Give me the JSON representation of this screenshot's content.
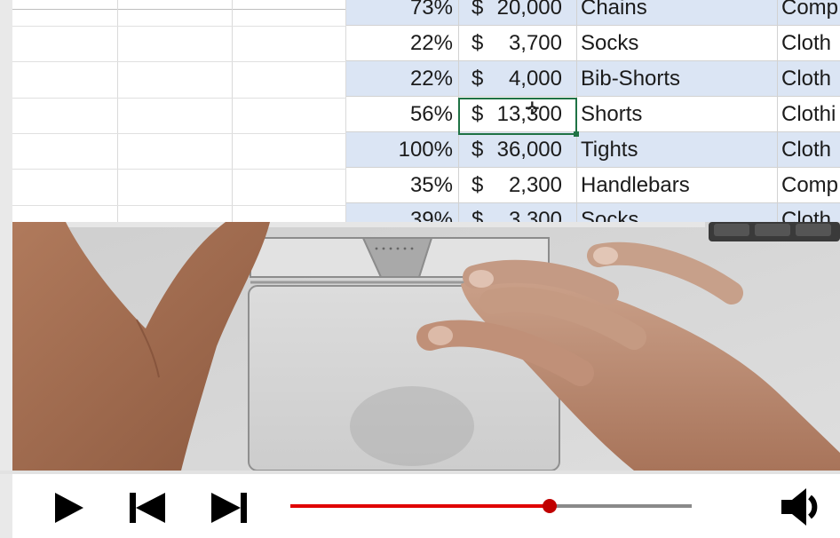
{
  "spreadsheet": {
    "rows": [
      {
        "pct": "73%",
        "sym": "$",
        "amt": "20,000",
        "name": "Chains",
        "cat": "Comp",
        "band": true
      },
      {
        "pct": "22%",
        "sym": "$",
        "amt": "3,700",
        "name": "Socks",
        "cat": "Cloth",
        "band": false
      },
      {
        "pct": "22%",
        "sym": "$",
        "amt": "4,000",
        "name": "Bib-Shorts",
        "cat": "Cloth",
        "band": true
      },
      {
        "pct": "56%",
        "sym": "$",
        "amt": "13,300",
        "name": "Shorts",
        "cat": "Clothi",
        "band": false
      },
      {
        "pct": "100%",
        "sym": "$",
        "amt": "36,000",
        "name": "Tights",
        "cat": "Cloth",
        "band": true
      },
      {
        "pct": "35%",
        "sym": "$",
        "amt": "2,300",
        "name": "Handlebars",
        "cat": "Comp",
        "band": false
      },
      {
        "pct": "39%",
        "sym": "$",
        "amt": "3,300",
        "name": "Socks",
        "cat": "Cloth",
        "band": true
      }
    ],
    "selected_cell": "$ 13,300"
  },
  "player": {
    "progress_fraction": 0.645,
    "colors": {
      "played": "#e00000",
      "thumb": "#c00000",
      "track": "#8a8a8a"
    },
    "icons": [
      "play-icon",
      "skip-previous-icon",
      "skip-next-icon",
      "volume-icon"
    ]
  }
}
